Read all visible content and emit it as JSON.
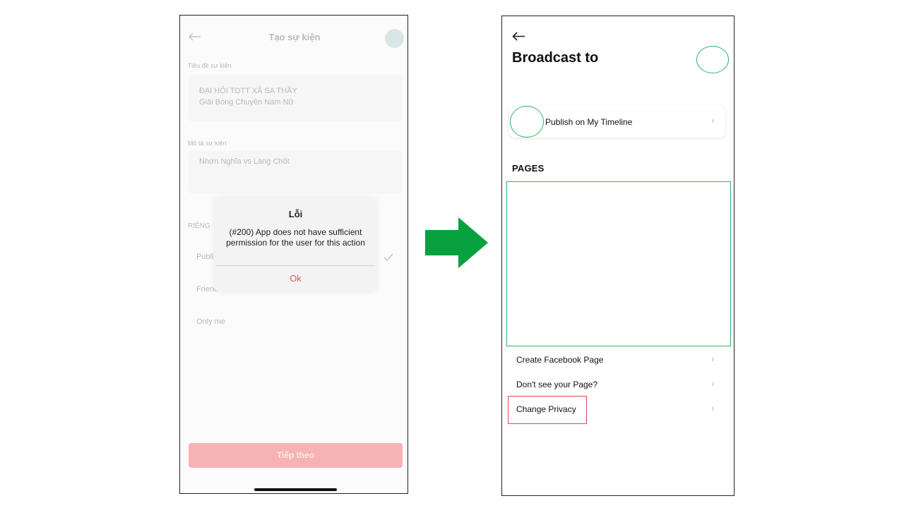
{
  "left_screen": {
    "header": {
      "title": "Tạo sự kiện",
      "back_icon": "back-arrow-icon"
    },
    "event_title": {
      "label": "Tiêu đề sự kiện",
      "line1": "ĐẠI HỘI TDTT XÃ SA THẦY",
      "line2": "Giải Bóng Chuyền Nam Nữ"
    },
    "event_desc": {
      "label": "Mô tả sự kiện",
      "value": "Nhơn Nghĩa vs Làng Chốt"
    },
    "privacy": {
      "section_partial": "RIÊNG",
      "options": [
        "Publi",
        "Friend",
        "Only me"
      ]
    },
    "dialog": {
      "title": "Lỗi",
      "message": "(#200) App does not have sufficient permission for the user for this action",
      "ok": "Ok"
    },
    "next_button": "Tiếp theo"
  },
  "right_screen": {
    "title": "Broadcast to",
    "timeline": "Publish on My Timeline",
    "pages_heading": "PAGES",
    "rows": [
      "Create Facebook Page",
      "Don't see your Page?",
      "Change Privacy"
    ],
    "chevron": "›"
  },
  "colors": {
    "arrow": "#08a13f",
    "highlight_green": "#2fb56a",
    "highlight_red": "#e24a4a",
    "accent_red": "#e05555"
  }
}
